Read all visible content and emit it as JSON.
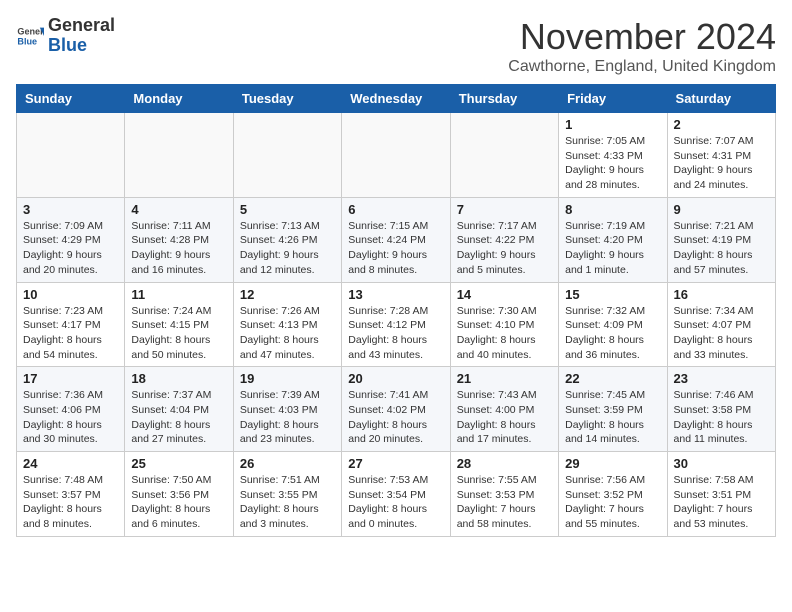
{
  "header": {
    "logo_general": "General",
    "logo_blue": "Blue",
    "month_title": "November 2024",
    "subtitle": "Cawthorne, England, United Kingdom"
  },
  "weekdays": [
    "Sunday",
    "Monday",
    "Tuesday",
    "Wednesday",
    "Thursday",
    "Friday",
    "Saturday"
  ],
  "weeks": [
    [
      {
        "day": "",
        "info": ""
      },
      {
        "day": "",
        "info": ""
      },
      {
        "day": "",
        "info": ""
      },
      {
        "day": "",
        "info": ""
      },
      {
        "day": "",
        "info": ""
      },
      {
        "day": "1",
        "info": "Sunrise: 7:05 AM\nSunset: 4:33 PM\nDaylight: 9 hours and 28 minutes."
      },
      {
        "day": "2",
        "info": "Sunrise: 7:07 AM\nSunset: 4:31 PM\nDaylight: 9 hours and 24 minutes."
      }
    ],
    [
      {
        "day": "3",
        "info": "Sunrise: 7:09 AM\nSunset: 4:29 PM\nDaylight: 9 hours and 20 minutes."
      },
      {
        "day": "4",
        "info": "Sunrise: 7:11 AM\nSunset: 4:28 PM\nDaylight: 9 hours and 16 minutes."
      },
      {
        "day": "5",
        "info": "Sunrise: 7:13 AM\nSunset: 4:26 PM\nDaylight: 9 hours and 12 minutes."
      },
      {
        "day": "6",
        "info": "Sunrise: 7:15 AM\nSunset: 4:24 PM\nDaylight: 9 hours and 8 minutes."
      },
      {
        "day": "7",
        "info": "Sunrise: 7:17 AM\nSunset: 4:22 PM\nDaylight: 9 hours and 5 minutes."
      },
      {
        "day": "8",
        "info": "Sunrise: 7:19 AM\nSunset: 4:20 PM\nDaylight: 9 hours and 1 minute."
      },
      {
        "day": "9",
        "info": "Sunrise: 7:21 AM\nSunset: 4:19 PM\nDaylight: 8 hours and 57 minutes."
      }
    ],
    [
      {
        "day": "10",
        "info": "Sunrise: 7:23 AM\nSunset: 4:17 PM\nDaylight: 8 hours and 54 minutes."
      },
      {
        "day": "11",
        "info": "Sunrise: 7:24 AM\nSunset: 4:15 PM\nDaylight: 8 hours and 50 minutes."
      },
      {
        "day": "12",
        "info": "Sunrise: 7:26 AM\nSunset: 4:13 PM\nDaylight: 8 hours and 47 minutes."
      },
      {
        "day": "13",
        "info": "Sunrise: 7:28 AM\nSunset: 4:12 PM\nDaylight: 8 hours and 43 minutes."
      },
      {
        "day": "14",
        "info": "Sunrise: 7:30 AM\nSunset: 4:10 PM\nDaylight: 8 hours and 40 minutes."
      },
      {
        "day": "15",
        "info": "Sunrise: 7:32 AM\nSunset: 4:09 PM\nDaylight: 8 hours and 36 minutes."
      },
      {
        "day": "16",
        "info": "Sunrise: 7:34 AM\nSunset: 4:07 PM\nDaylight: 8 hours and 33 minutes."
      }
    ],
    [
      {
        "day": "17",
        "info": "Sunrise: 7:36 AM\nSunset: 4:06 PM\nDaylight: 8 hours and 30 minutes."
      },
      {
        "day": "18",
        "info": "Sunrise: 7:37 AM\nSunset: 4:04 PM\nDaylight: 8 hours and 27 minutes."
      },
      {
        "day": "19",
        "info": "Sunrise: 7:39 AM\nSunset: 4:03 PM\nDaylight: 8 hours and 23 minutes."
      },
      {
        "day": "20",
        "info": "Sunrise: 7:41 AM\nSunset: 4:02 PM\nDaylight: 8 hours and 20 minutes."
      },
      {
        "day": "21",
        "info": "Sunrise: 7:43 AM\nSunset: 4:00 PM\nDaylight: 8 hours and 17 minutes."
      },
      {
        "day": "22",
        "info": "Sunrise: 7:45 AM\nSunset: 3:59 PM\nDaylight: 8 hours and 14 minutes."
      },
      {
        "day": "23",
        "info": "Sunrise: 7:46 AM\nSunset: 3:58 PM\nDaylight: 8 hours and 11 minutes."
      }
    ],
    [
      {
        "day": "24",
        "info": "Sunrise: 7:48 AM\nSunset: 3:57 PM\nDaylight: 8 hours and 8 minutes."
      },
      {
        "day": "25",
        "info": "Sunrise: 7:50 AM\nSunset: 3:56 PM\nDaylight: 8 hours and 6 minutes."
      },
      {
        "day": "26",
        "info": "Sunrise: 7:51 AM\nSunset: 3:55 PM\nDaylight: 8 hours and 3 minutes."
      },
      {
        "day": "27",
        "info": "Sunrise: 7:53 AM\nSunset: 3:54 PM\nDaylight: 8 hours and 0 minutes."
      },
      {
        "day": "28",
        "info": "Sunrise: 7:55 AM\nSunset: 3:53 PM\nDaylight: 7 hours and 58 minutes."
      },
      {
        "day": "29",
        "info": "Sunrise: 7:56 AM\nSunset: 3:52 PM\nDaylight: 7 hours and 55 minutes."
      },
      {
        "day": "30",
        "info": "Sunrise: 7:58 AM\nSunset: 3:51 PM\nDaylight: 7 hours and 53 minutes."
      }
    ]
  ]
}
